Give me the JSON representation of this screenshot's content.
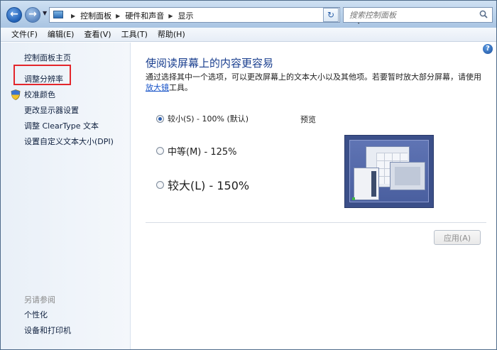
{
  "address_bar": {
    "breadcrumbs": [
      "控制面板",
      "硬件和声音",
      "显示"
    ]
  },
  "search": {
    "placeholder": "搜索控制面板"
  },
  "menu": {
    "items": [
      "文件(F)",
      "编辑(E)",
      "查看(V)",
      "工具(T)",
      "帮助(H)"
    ]
  },
  "sidebar": {
    "items": [
      {
        "label": "控制面板主页"
      },
      {
        "label": "调整分辨率",
        "highlighted": true
      },
      {
        "label": "校准颜色",
        "icon": "shield-icon"
      },
      {
        "label": "更改显示器设置"
      },
      {
        "label": "调整 ClearType 文本"
      },
      {
        "label": "设置自定义文本大小(DPI)"
      }
    ],
    "see_also": {
      "title": "另请参阅",
      "items": [
        "个性化",
        "设备和打印机"
      ]
    }
  },
  "main": {
    "heading": "使阅读屏幕上的内容更容易",
    "description_before_link": "通过选择其中一个选项，可以更改屏幕上的文本大小以及其他项。若要暂时放大部分屏幕，请使用",
    "description_link": "放大镜",
    "description_after_link": "工具。",
    "options": [
      {
        "label": "较小(S) - 100% (默认)",
        "selected": true
      },
      {
        "label": "中等(M) - 125%",
        "selected": false
      },
      {
        "label": "较大(L) - 150%",
        "selected": false
      }
    ],
    "preview_label": "预览",
    "apply_label": "应用(A)",
    "help_symbol": "?"
  },
  "colors": {
    "heading": "#1a3f8f",
    "link": "#1a55c8",
    "highlight_box": "#e3262c"
  }
}
